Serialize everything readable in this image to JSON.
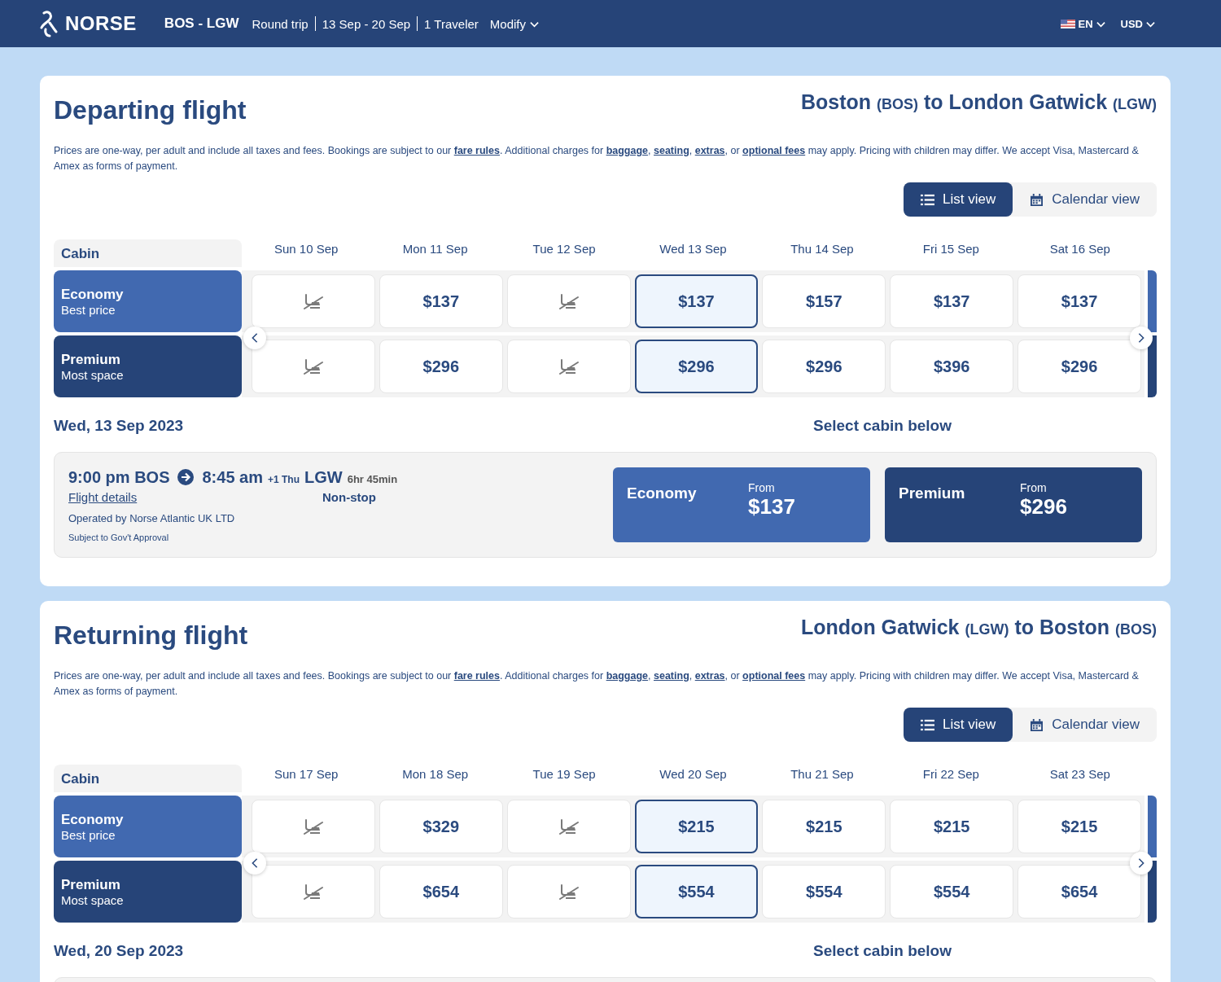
{
  "header": {
    "logo": "NORSE",
    "route": "BOS - LGW",
    "trip": [
      "Round trip",
      "13 Sep - 20 Sep",
      "1 Traveler"
    ],
    "modify": "Modify",
    "language": "EN",
    "currency": "USD"
  },
  "sections": [
    {
      "title": "Departing flight",
      "route": {
        "from": "Boston",
        "from_code": "(BOS)",
        "connector": "to",
        "to": "London Gatwick",
        "to_code": "(LGW)"
      },
      "notice": "Prices are one-way, per adult and include all taxes and fees. Bookings are subject to our **fare rules**. Additional charges for **baggage**, **seating**, **extras**, or **optional fees** may apply. Pricing with children may differ. We accept Visa, Mastercard & Amex as forms of payment.",
      "views": [
        {
          "kind": "list",
          "label": "List view",
          "selected": true
        },
        {
          "kind": "calendar",
          "label": "Calendar view",
          "selected": false
        }
      ],
      "cabin_header": "Cabin",
      "dates": [
        {
          "label": "Sun 10 Sep",
          "selected": false
        },
        {
          "label": "Mon 11 Sep",
          "selected": false
        },
        {
          "label": "Tue 12 Sep",
          "selected": false
        },
        {
          "label": "Wed 13 Sep",
          "selected": true
        },
        {
          "label": "Thu 14 Sep",
          "selected": false
        },
        {
          "label": "Fri 15 Sep",
          "selected": false
        },
        {
          "label": "Sat 16 Sep",
          "selected": false
        }
      ],
      "cabins": [
        {
          "kind": "economy",
          "name": "Economy",
          "subtitle": "Best price",
          "fares": [
            {
              "available": false
            },
            {
              "available": true,
              "price": "$137"
            },
            {
              "available": false
            },
            {
              "available": true,
              "price": "$137"
            },
            {
              "available": true,
              "price": "$157"
            },
            {
              "available": true,
              "price": "$137"
            },
            {
              "available": true,
              "price": "$137"
            }
          ]
        },
        {
          "kind": "premium",
          "name": "Premium",
          "subtitle": "Most space",
          "fares": [
            {
              "available": false
            },
            {
              "available": true,
              "price": "$296"
            },
            {
              "available": false
            },
            {
              "available": true,
              "price": "$296"
            },
            {
              "available": true,
              "price": "$296"
            },
            {
              "available": true,
              "price": "$396"
            },
            {
              "available": true,
              "price": "$296"
            }
          ]
        }
      ],
      "selected_date": "Wed, 13 Sep 2023",
      "select_prompt": "Select cabin below",
      "flight": {
        "depart_time": "9:00 pm",
        "depart_code": "BOS",
        "arrive_time": "8:45 am",
        "day_offset": "+1 Thu",
        "arrive_code": "LGW",
        "duration": "6hr 45min",
        "details_link": "Flight details",
        "stops": "Non-stop",
        "operator": "Operated by Norse Atlantic UK LTD",
        "note": "Subject to Gov't Approval",
        "cabins": [
          {
            "kind": "economy",
            "name": "Economy",
            "from_label": "From",
            "price": "$137"
          },
          {
            "kind": "premium",
            "name": "Premium",
            "from_label": "From",
            "price": "$296"
          }
        ]
      }
    },
    {
      "title": "Returning flight",
      "route": {
        "from": "London Gatwick",
        "from_code": "(LGW)",
        "connector": "to",
        "to": "Boston",
        "to_code": "(BOS)"
      },
      "notice": "Prices are one-way, per adult and include all taxes and fees. Bookings are subject to our **fare rules**. Additional charges for **baggage**, **seating**, **extras**, or **optional fees** may apply. Pricing with children may differ. We accept Visa, Mastercard & Amex as forms of payment.",
      "views": [
        {
          "kind": "list",
          "label": "List view",
          "selected": true
        },
        {
          "kind": "calendar",
          "label": "Calendar view",
          "selected": false
        }
      ],
      "cabin_header": "Cabin",
      "dates": [
        {
          "label": "Sun 17 Sep",
          "selected": false
        },
        {
          "label": "Mon 18 Sep",
          "selected": false
        },
        {
          "label": "Tue 19 Sep",
          "selected": false
        },
        {
          "label": "Wed 20 Sep",
          "selected": true
        },
        {
          "label": "Thu 21 Sep",
          "selected": false
        },
        {
          "label": "Fri 22 Sep",
          "selected": false
        },
        {
          "label": "Sat 23 Sep",
          "selected": false
        }
      ],
      "cabins": [
        {
          "kind": "economy",
          "name": "Economy",
          "subtitle": "Best price",
          "fares": [
            {
              "available": false
            },
            {
              "available": true,
              "price": "$329"
            },
            {
              "available": false
            },
            {
              "available": true,
              "price": "$215"
            },
            {
              "available": true,
              "price": "$215"
            },
            {
              "available": true,
              "price": "$215"
            },
            {
              "available": true,
              "price": "$215"
            }
          ]
        },
        {
          "kind": "premium",
          "name": "Premium",
          "subtitle": "Most space",
          "fares": [
            {
              "available": false
            },
            {
              "available": true,
              "price": "$654"
            },
            {
              "available": false
            },
            {
              "available": true,
              "price": "$554"
            },
            {
              "available": true,
              "price": "$554"
            },
            {
              "available": true,
              "price": "$554"
            },
            {
              "available": true,
              "price": "$654"
            }
          ]
        }
      ],
      "selected_date": "Wed, 20 Sep 2023",
      "select_prompt": "Select cabin below"
    }
  ]
}
